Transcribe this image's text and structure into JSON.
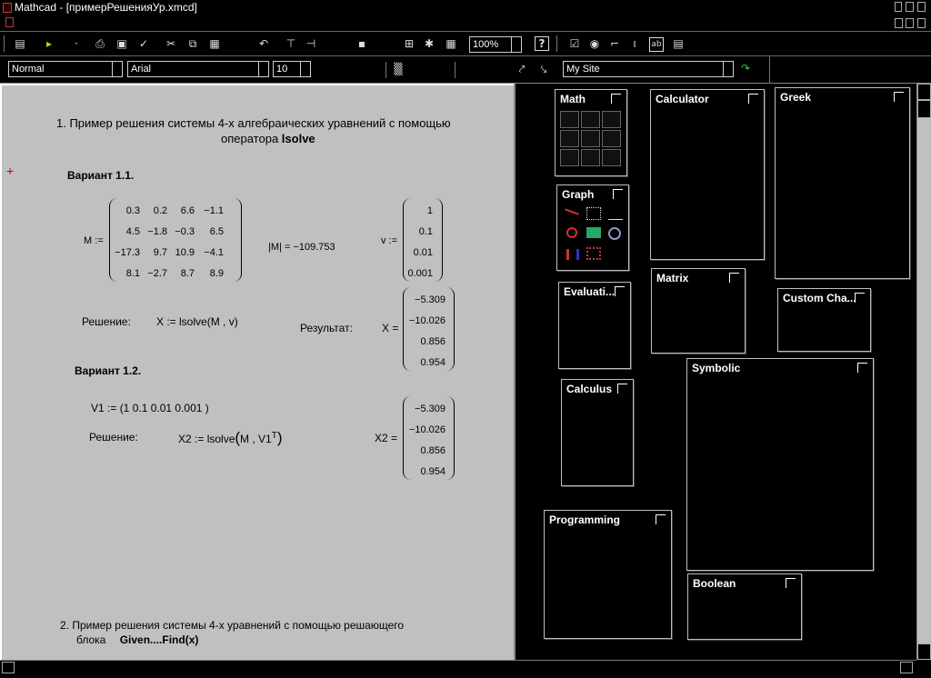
{
  "window": {
    "title": "Mathcad - [примерРешенияУр.xmcd]"
  },
  "toolbar": {
    "zoom": "100%"
  },
  "format_bar": {
    "style": "Normal",
    "font": "Arial",
    "size": "10",
    "resource": "My Site"
  },
  "doc": {
    "heading1_line1": "1.  Пример решения  системы 4-х алгебраических уравнений с помощью",
    "heading1_line2_prefix": "оператора",
    "heading1_line2_op": "lsolve",
    "variant1": "Вариант 1.1.",
    "variant2": "Вариант 1.2.",
    "M_label": "M :=",
    "M_rows": [
      [
        "0.3",
        "0.2",
        "6.6",
        "−1.1"
      ],
      [
        "4.5",
        "−1.8",
        "−0.3",
        "6.5"
      ],
      [
        "−17.3",
        "9.7",
        "10.9",
        "−4.1"
      ],
      [
        "8.1",
        "−2.7",
        "8.7",
        "8.9"
      ]
    ],
    "det_label": "|M| = −109.753",
    "v_label": "v :=",
    "v_values": [
      "1",
      "0.1",
      "0.01",
      "0.001"
    ],
    "solution_label": "Решение:",
    "solve_expr": "X := lsolve(M , v)",
    "result_label": "Результат:",
    "X_label": "X =",
    "X_values": [
      "−5.309",
      "−10.026",
      "0.856",
      "0.954"
    ],
    "V1_expr": "V1 := (1   0.1   0.01   0.001 )",
    "solution2_label": "Решение:",
    "solve2_prefix": "X2 := lsolve",
    "solve2_args": "M , V1",
    "solve2_sup": "T",
    "X2_label": "X2 =",
    "X2_values": [
      "−5.309",
      "−10.026",
      "0.856",
      "0.954"
    ],
    "heading2_line1": "2. Пример решения системы 4-х уравнений с помощью решающего",
    "heading2_line2_prefix": "блока",
    "heading2_line2_bold": "Given....Find(x)"
  },
  "palettes": {
    "math": "Math",
    "graph": "Graph",
    "evaluation": "Evaluati...",
    "calculus": "Calculus",
    "programming": "Programming",
    "calculator": "Calculator",
    "matrix": "Matrix",
    "symbolic": "Symbolic",
    "boolean": "Boolean",
    "greek": "Greek",
    "custom": "Custom Cha..."
  }
}
